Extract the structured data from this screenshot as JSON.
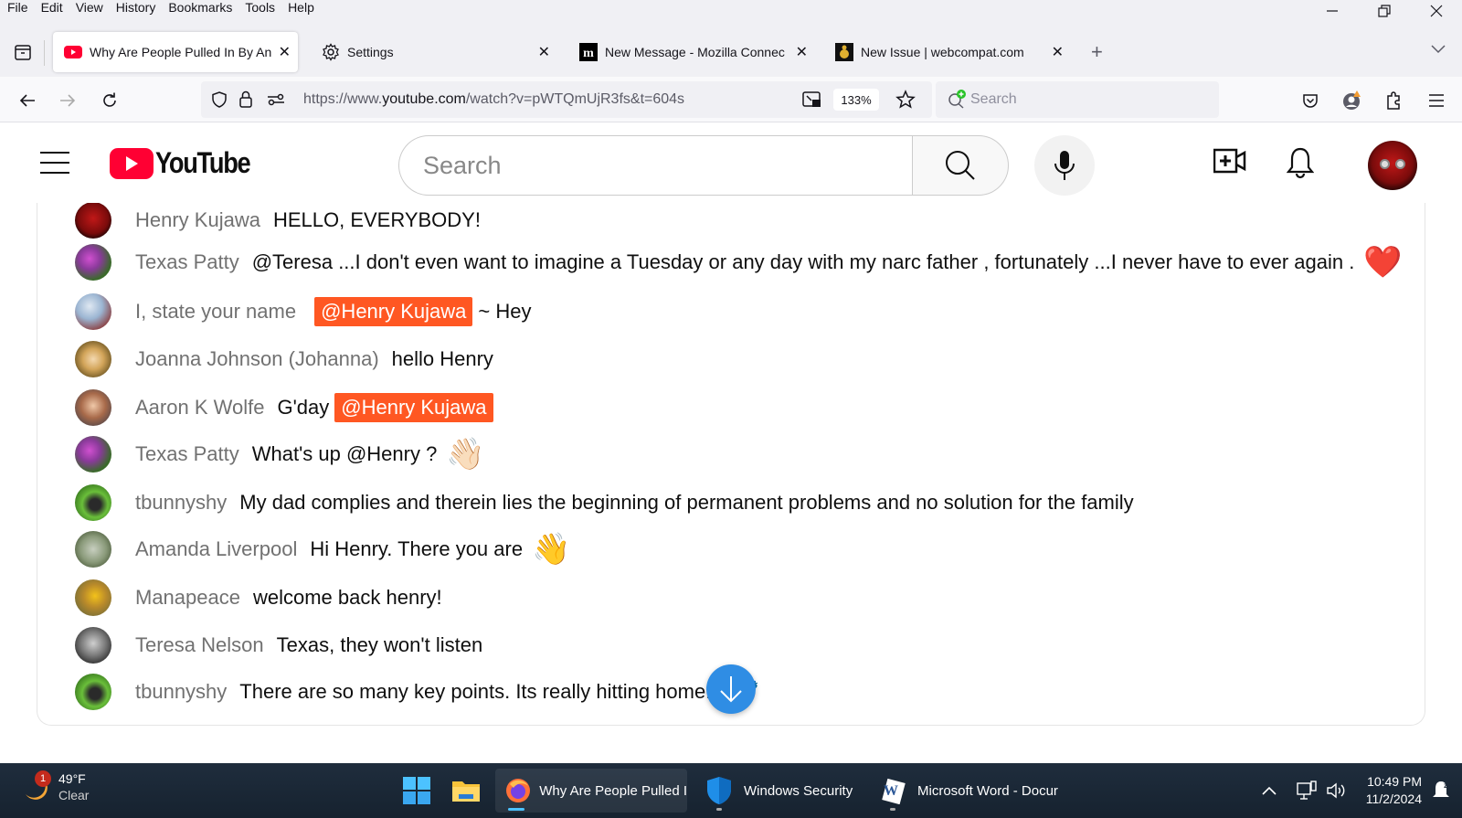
{
  "menubar": {
    "items": [
      "File",
      "Edit",
      "View",
      "History",
      "Bookmarks",
      "Tools",
      "Help"
    ]
  },
  "window_controls": {
    "minimize": "minimize-icon",
    "restore": "restore-icon",
    "close": "close-icon"
  },
  "tabs": [
    {
      "title": "Why Are People Pulled In By An",
      "icon": "youtube-icon",
      "active": true
    },
    {
      "title": "Settings",
      "icon": "gear-icon",
      "active": false
    },
    {
      "title": "New Message - Mozilla Connec",
      "icon": "mozilla-m-icon",
      "active": false
    },
    {
      "title": "New Issue | webcompat.com",
      "icon": "webcompat-icon",
      "active": false
    }
  ],
  "navbar": {
    "url_prefix": "https://www.",
    "url_domain": "youtube.com",
    "url_rest": "/watch?v=pWTQmUjR3fs&t=604s",
    "zoom": "133%",
    "search_placeholder": "Search"
  },
  "youtube": {
    "logo_text": "YouTube",
    "search_placeholder": "Search"
  },
  "chat": {
    "messages": [
      {
        "author": "Henry Kujawa",
        "parts": [
          {
            "t": "text",
            "v": "HELLO, EVERYBODY!"
          }
        ],
        "avatar": "robot"
      },
      {
        "author": "Texas Patty",
        "parts": [
          {
            "t": "text",
            "v": "@Teresa ...I don't even want to imagine a Tuesday or any day with my narc father , fortunately ...I never have to ever again ."
          },
          {
            "t": "emoji",
            "v": "❤️"
          }
        ],
        "avatar": "flowers"
      },
      {
        "author": "I, state your name",
        "parts": [
          {
            "t": "mention",
            "v": "@Henry Kujawa"
          },
          {
            "t": "text",
            "v": "~ Hey"
          }
        ],
        "avatar": "bird"
      },
      {
        "author": "Joanna Johnson (Johanna)",
        "parts": [
          {
            "t": "text",
            "v": "hello Henry"
          }
        ],
        "avatar": "blonde"
      },
      {
        "author": "Aaron K Wolfe",
        "parts": [
          {
            "t": "text",
            "v": "G'day"
          },
          {
            "t": "mention",
            "v": "@Henry Kujawa"
          }
        ],
        "avatar": "man"
      },
      {
        "author": "Texas Patty",
        "parts": [
          {
            "t": "text",
            "v": "What's up @Henry ?"
          },
          {
            "t": "emoji",
            "v": "👋🏻"
          }
        ],
        "avatar": "flowers"
      },
      {
        "author": "tbunnyshy",
        "parts": [
          {
            "t": "text",
            "v": "My dad complies and therein lies the beginning of permanent problems and no solution for the family"
          }
        ],
        "avatar": "stones"
      },
      {
        "author": "Amanda Liverpool",
        "parts": [
          {
            "t": "text",
            "v": "Hi Henry. There you are"
          },
          {
            "t": "emoji",
            "v": "👋"
          }
        ],
        "avatar": "plant"
      },
      {
        "author": "Manapeace",
        "parts": [
          {
            "t": "text",
            "v": "welcome back henry!"
          }
        ],
        "avatar": "sunflower"
      },
      {
        "author": "Teresa Nelson",
        "parts": [
          {
            "t": "text",
            "v": "Texas, they won't listen"
          }
        ],
        "avatar": "bw"
      },
      {
        "author": "tbunnyshy",
        "parts": [
          {
            "t": "text",
            "v": "There are so many key points. Its really hitting home!"
          },
          {
            "t": "emoji",
            "v": "🎯"
          }
        ],
        "avatar": "stones"
      }
    ],
    "mention_color": "#ff5722",
    "scroll_button_color": "#2f8de4"
  },
  "taskbar": {
    "weather_temp": "49°F",
    "weather_cond": "Clear",
    "weather_badge": "1",
    "apps": [
      {
        "label": "Why Are People Pulled I",
        "icon": "firefox-icon",
        "active": true
      },
      {
        "label": "Windows Security",
        "icon": "shield-icon",
        "active": false
      },
      {
        "label": "Microsoft Word - Docur",
        "icon": "word-icon",
        "active": false
      }
    ],
    "time": "10:49 PM",
    "date": "11/2/2024"
  }
}
